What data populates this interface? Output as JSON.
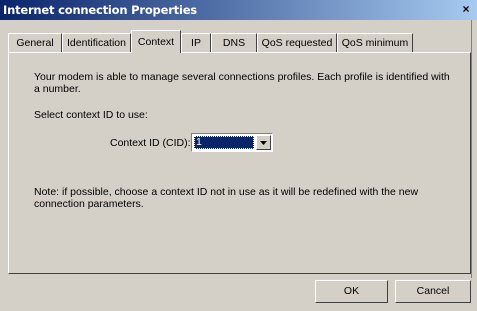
{
  "window": {
    "title": "Internet connection Properties",
    "close_label": "×"
  },
  "tabs": [
    {
      "label": "General",
      "active": false
    },
    {
      "label": "Identification",
      "active": false
    },
    {
      "label": "Context",
      "active": true
    },
    {
      "label": "IP",
      "active": false
    },
    {
      "label": "DNS",
      "active": false
    },
    {
      "label": "QoS requested",
      "active": false
    },
    {
      "label": "QoS minimum",
      "active": false
    }
  ],
  "context": {
    "intro": "Your modem is able to manage several connections profiles. Each profile is identified with a number.",
    "select_prompt": "Select context ID to use:",
    "cid_label": "Context ID (CID):",
    "cid_value": "1",
    "note": "Note: if possible, choose a context ID not in use as it will be redefined with the new connection parameters."
  },
  "buttons": {
    "ok": "OK",
    "cancel": "Cancel"
  },
  "colors": {
    "titlebar_start": "#0a246a",
    "titlebar_end": "#a6caf0",
    "face": "#d4d0c8",
    "selection": "#0a246a"
  }
}
